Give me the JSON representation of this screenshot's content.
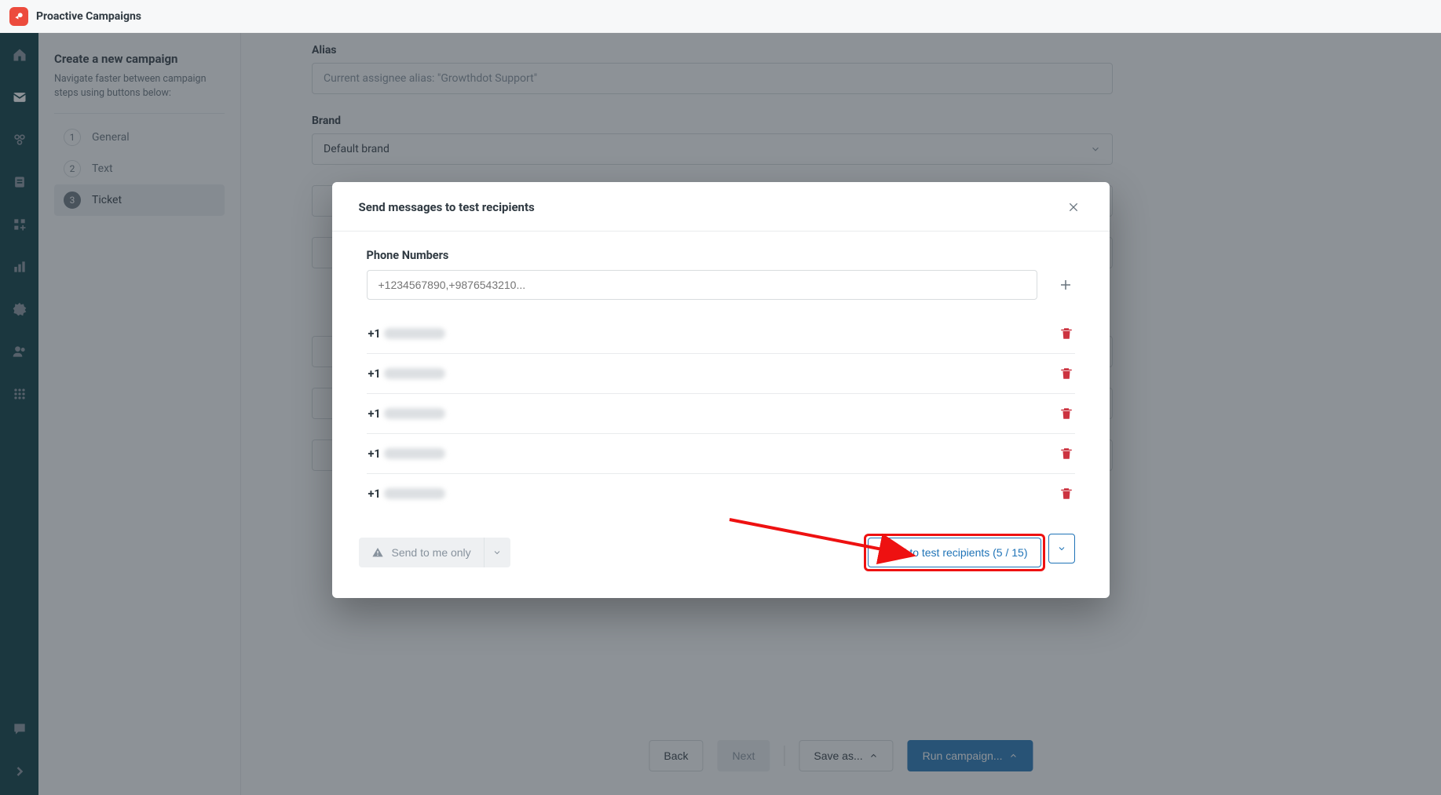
{
  "header": {
    "app_title": "Proactive Campaigns"
  },
  "sidebar": {
    "title": "Create a new campaign",
    "subtitle": "Navigate faster between campaign steps using buttons below:",
    "steps": [
      {
        "num": "1",
        "label": "General"
      },
      {
        "num": "2",
        "label": "Text"
      },
      {
        "num": "3",
        "label": "Ticket"
      }
    ]
  },
  "form": {
    "alias_label": "Alias",
    "alias_placeholder": "Current assignee alias: \"Growthdot Support\"",
    "brand_label": "Brand",
    "brand_value": "Default brand"
  },
  "footer": {
    "back": "Back",
    "next": "Next",
    "save_as": "Save as...",
    "run": "Run campaign..."
  },
  "modal": {
    "title": "Send messages to test recipients",
    "phone_label": "Phone Numbers",
    "phone_placeholder": "+1234567890,+9876543210...",
    "numbers": [
      {
        "prefix": "+1"
      },
      {
        "prefix": "+1"
      },
      {
        "prefix": "+1"
      },
      {
        "prefix": "+1"
      },
      {
        "prefix": "+1"
      }
    ],
    "send_me_label": "Send to me only",
    "send_test_label": "Send to test recipients (5 / 15)"
  }
}
